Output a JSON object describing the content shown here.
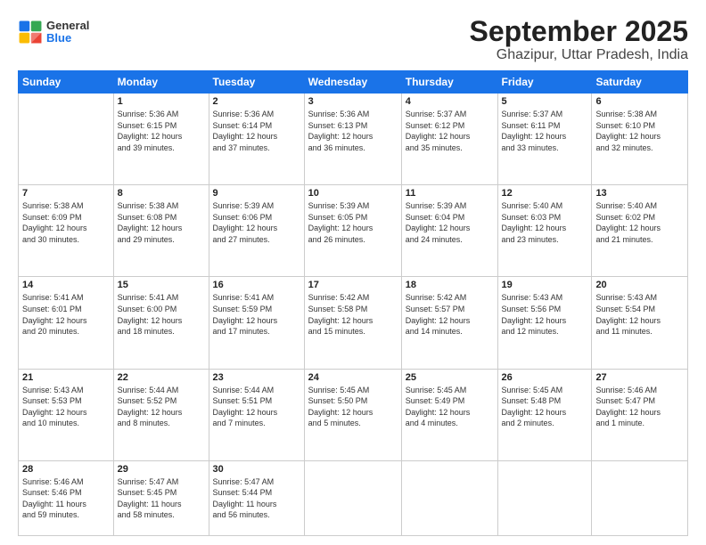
{
  "header": {
    "logo": {
      "general": "General",
      "blue": "Blue"
    },
    "title": "September 2025",
    "subtitle": "Ghazipur, Uttar Pradesh, India"
  },
  "days_of_week": [
    "Sunday",
    "Monday",
    "Tuesday",
    "Wednesday",
    "Thursday",
    "Friday",
    "Saturday"
  ],
  "weeks": [
    [
      {
        "num": "",
        "info": ""
      },
      {
        "num": "1",
        "info": "Sunrise: 5:36 AM\nSunset: 6:15 PM\nDaylight: 12 hours\nand 39 minutes."
      },
      {
        "num": "2",
        "info": "Sunrise: 5:36 AM\nSunset: 6:14 PM\nDaylight: 12 hours\nand 37 minutes."
      },
      {
        "num": "3",
        "info": "Sunrise: 5:36 AM\nSunset: 6:13 PM\nDaylight: 12 hours\nand 36 minutes."
      },
      {
        "num": "4",
        "info": "Sunrise: 5:37 AM\nSunset: 6:12 PM\nDaylight: 12 hours\nand 35 minutes."
      },
      {
        "num": "5",
        "info": "Sunrise: 5:37 AM\nSunset: 6:11 PM\nDaylight: 12 hours\nand 33 minutes."
      },
      {
        "num": "6",
        "info": "Sunrise: 5:38 AM\nSunset: 6:10 PM\nDaylight: 12 hours\nand 32 minutes."
      }
    ],
    [
      {
        "num": "7",
        "info": "Sunrise: 5:38 AM\nSunset: 6:09 PM\nDaylight: 12 hours\nand 30 minutes."
      },
      {
        "num": "8",
        "info": "Sunrise: 5:38 AM\nSunset: 6:08 PM\nDaylight: 12 hours\nand 29 minutes."
      },
      {
        "num": "9",
        "info": "Sunrise: 5:39 AM\nSunset: 6:06 PM\nDaylight: 12 hours\nand 27 minutes."
      },
      {
        "num": "10",
        "info": "Sunrise: 5:39 AM\nSunset: 6:05 PM\nDaylight: 12 hours\nand 26 minutes."
      },
      {
        "num": "11",
        "info": "Sunrise: 5:39 AM\nSunset: 6:04 PM\nDaylight: 12 hours\nand 24 minutes."
      },
      {
        "num": "12",
        "info": "Sunrise: 5:40 AM\nSunset: 6:03 PM\nDaylight: 12 hours\nand 23 minutes."
      },
      {
        "num": "13",
        "info": "Sunrise: 5:40 AM\nSunset: 6:02 PM\nDaylight: 12 hours\nand 21 minutes."
      }
    ],
    [
      {
        "num": "14",
        "info": "Sunrise: 5:41 AM\nSunset: 6:01 PM\nDaylight: 12 hours\nand 20 minutes."
      },
      {
        "num": "15",
        "info": "Sunrise: 5:41 AM\nSunset: 6:00 PM\nDaylight: 12 hours\nand 18 minutes."
      },
      {
        "num": "16",
        "info": "Sunrise: 5:41 AM\nSunset: 5:59 PM\nDaylight: 12 hours\nand 17 minutes."
      },
      {
        "num": "17",
        "info": "Sunrise: 5:42 AM\nSunset: 5:58 PM\nDaylight: 12 hours\nand 15 minutes."
      },
      {
        "num": "18",
        "info": "Sunrise: 5:42 AM\nSunset: 5:57 PM\nDaylight: 12 hours\nand 14 minutes."
      },
      {
        "num": "19",
        "info": "Sunrise: 5:43 AM\nSunset: 5:56 PM\nDaylight: 12 hours\nand 12 minutes."
      },
      {
        "num": "20",
        "info": "Sunrise: 5:43 AM\nSunset: 5:54 PM\nDaylight: 12 hours\nand 11 minutes."
      }
    ],
    [
      {
        "num": "21",
        "info": "Sunrise: 5:43 AM\nSunset: 5:53 PM\nDaylight: 12 hours\nand 10 minutes."
      },
      {
        "num": "22",
        "info": "Sunrise: 5:44 AM\nSunset: 5:52 PM\nDaylight: 12 hours\nand 8 minutes."
      },
      {
        "num": "23",
        "info": "Sunrise: 5:44 AM\nSunset: 5:51 PM\nDaylight: 12 hours\nand 7 minutes."
      },
      {
        "num": "24",
        "info": "Sunrise: 5:45 AM\nSunset: 5:50 PM\nDaylight: 12 hours\nand 5 minutes."
      },
      {
        "num": "25",
        "info": "Sunrise: 5:45 AM\nSunset: 5:49 PM\nDaylight: 12 hours\nand 4 minutes."
      },
      {
        "num": "26",
        "info": "Sunrise: 5:45 AM\nSunset: 5:48 PM\nDaylight: 12 hours\nand 2 minutes."
      },
      {
        "num": "27",
        "info": "Sunrise: 5:46 AM\nSunset: 5:47 PM\nDaylight: 12 hours\nand 1 minute."
      }
    ],
    [
      {
        "num": "28",
        "info": "Sunrise: 5:46 AM\nSunset: 5:46 PM\nDaylight: 11 hours\nand 59 minutes."
      },
      {
        "num": "29",
        "info": "Sunrise: 5:47 AM\nSunset: 5:45 PM\nDaylight: 11 hours\nand 58 minutes."
      },
      {
        "num": "30",
        "info": "Sunrise: 5:47 AM\nSunset: 5:44 PM\nDaylight: 11 hours\nand 56 minutes."
      },
      {
        "num": "",
        "info": ""
      },
      {
        "num": "",
        "info": ""
      },
      {
        "num": "",
        "info": ""
      },
      {
        "num": "",
        "info": ""
      }
    ]
  ]
}
